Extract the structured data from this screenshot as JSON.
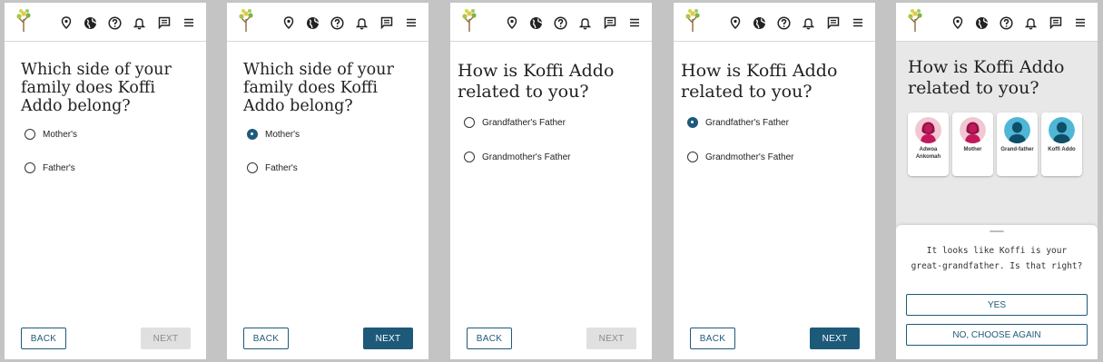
{
  "colors": {
    "accent": "#1d5a7a",
    "disabled": "#e0e0e0",
    "female_avatar": "#c2185b",
    "male_avatar": "#4fb6d6"
  },
  "topbar_icons": [
    "location-pin-icon",
    "globe-icon",
    "help-icon",
    "bell-icon",
    "messages-icon",
    "menu-icon"
  ],
  "screens": [
    {
      "question": "Which side of your family does Koffi Addo belong?",
      "options": [
        {
          "label": "Mother's",
          "selected": false
        },
        {
          "label": "Father's",
          "selected": false
        }
      ],
      "back_label": "BACK",
      "next_label": "NEXT",
      "next_enabled": false
    },
    {
      "question": "Which side of your family does Koffi Addo belong?",
      "options": [
        {
          "label": "Mother's",
          "selected": true
        },
        {
          "label": "Father's",
          "selected": false
        }
      ],
      "back_label": "BACK",
      "next_label": "NEXT",
      "next_enabled": true
    },
    {
      "question": "How is Koffi Addo related to you?",
      "options": [
        {
          "label": "Grandfather's Father",
          "selected": false
        },
        {
          "label": "Grandmother's Father",
          "selected": false
        }
      ],
      "back_label": "BACK",
      "next_label": "NEXT",
      "next_enabled": false
    },
    {
      "question": "How is Koffi Addo related to you?",
      "options": [
        {
          "label": "Grandfather's Father",
          "selected": true
        },
        {
          "label": "Grandmother's Father",
          "selected": false
        }
      ],
      "back_label": "BACK",
      "next_label": "NEXT",
      "next_enabled": true
    },
    {
      "question": "How is Koffi Addo related to you?",
      "cards": [
        {
          "name": "Adwoa Ankomah",
          "gender": "female"
        },
        {
          "name": "Mother",
          "gender": "female"
        },
        {
          "name": "Grand-father",
          "gender": "male"
        },
        {
          "name": "Koffi Addo",
          "gender": "male"
        }
      ],
      "confirm_text": "It looks like Koffi is your great-grandfather. Is that right?",
      "yes_label": "YES",
      "no_label": "NO, CHOOSE AGAIN"
    }
  ]
}
